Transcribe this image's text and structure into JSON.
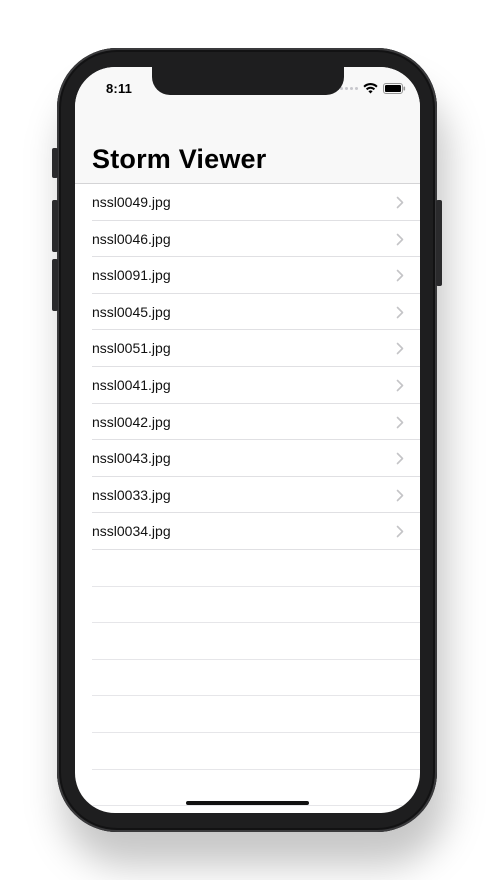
{
  "status_bar": {
    "time": "8:11"
  },
  "navigation": {
    "title": "Storm Viewer"
  },
  "pictures": [
    {
      "label": "nssl0049.jpg"
    },
    {
      "label": "nssl0046.jpg"
    },
    {
      "label": "nssl0091.jpg"
    },
    {
      "label": "nssl0045.jpg"
    },
    {
      "label": "nssl0051.jpg"
    },
    {
      "label": "nssl0041.jpg"
    },
    {
      "label": "nssl0042.jpg"
    },
    {
      "label": "nssl0043.jpg"
    },
    {
      "label": "nssl0033.jpg"
    },
    {
      "label": "nssl0034.jpg"
    }
  ],
  "icons": {
    "wifi": "wifi-icon",
    "battery": "battery-icon",
    "signal": "cellular-signal-icon",
    "disclosure": "chevron-right-icon"
  },
  "colors": {
    "device_frame": "#1e1e1f",
    "navbar_background": "#f8f8f8",
    "separator": "#e0e0e3",
    "chevron": "#c4c4c7"
  }
}
